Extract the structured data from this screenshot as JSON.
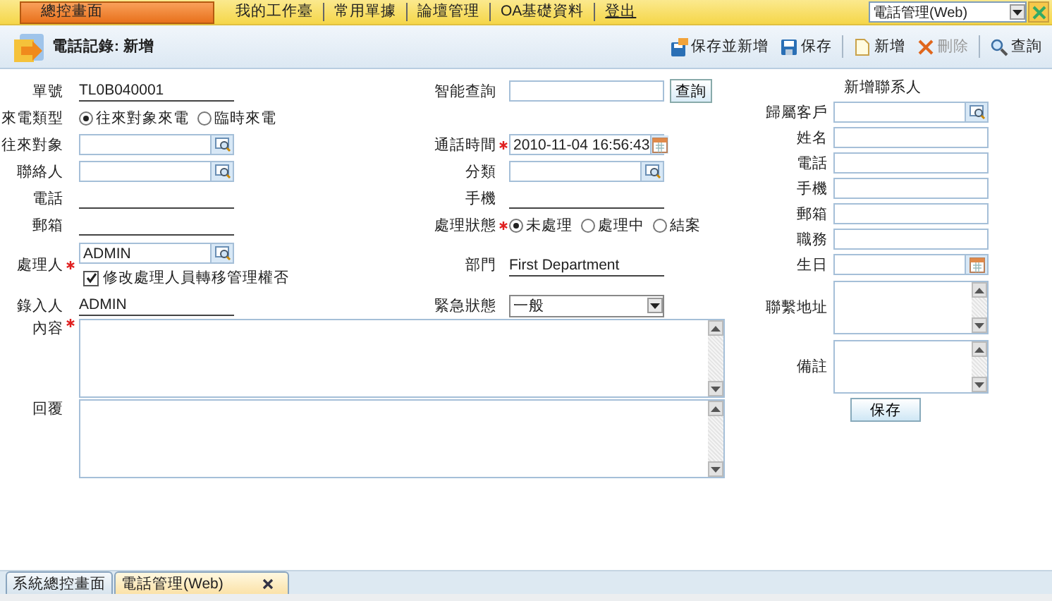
{
  "top_nav": {
    "items": [
      {
        "label": "總控畫面",
        "kind": "tab",
        "selected": true
      },
      {
        "label": "我的工作臺",
        "kind": "tab",
        "selected": false
      },
      {
        "label": "常用單據",
        "kind": "tab",
        "selected": false
      },
      {
        "label": "論壇管理",
        "kind": "tab",
        "selected": false
      },
      {
        "label": "OA基礎資料",
        "kind": "tab",
        "selected": false
      },
      {
        "label": "登出",
        "kind": "link",
        "selected": false
      }
    ],
    "module_select": {
      "value": "電話管理(Web)"
    }
  },
  "page_header": {
    "title": "電話記錄: 新增",
    "actions": [
      {
        "label": "保存並新增",
        "kind": "save_new",
        "disabled": false
      },
      {
        "label": "保存",
        "kind": "save",
        "disabled": false
      },
      {
        "label": "新增",
        "kind": "new",
        "disabled": false
      },
      {
        "label": "刪除",
        "kind": "delete",
        "disabled": true
      },
      {
        "label": "查詢",
        "kind": "search",
        "disabled": false
      }
    ]
  },
  "rows": [
    {
      "left": {
        "label": "單號",
        "kind": "text",
        "value": "TL0B040001"
      },
      "right": {
        "label": "智能查詢",
        "kind": "search",
        "button": "查詢"
      }
    },
    {
      "left": {
        "label": "來電類型",
        "kind": "radio",
        "options": [
          {
            "label": "往來對象來電",
            "selected": true
          },
          {
            "label": "臨時來電",
            "selected": false
          }
        ]
      }
    },
    {
      "left": {
        "label": "往來對象",
        "kind": "lookup"
      },
      "right": {
        "label": "通話時間",
        "required": true,
        "kind": "date",
        "value": "2010-11-04 16:56:43"
      }
    },
    {
      "left": {
        "label": "聯絡人",
        "kind": "lookup"
      },
      "right": {
        "label": "分類",
        "kind": "lookup"
      }
    },
    {
      "left": {
        "label": "電話",
        "kind": "text"
      },
      "right": {
        "label": "手機",
        "kind": "text"
      }
    },
    {
      "left": {
        "label": "郵箱",
        "kind": "text"
      },
      "right": {
        "label": "處理狀態",
        "required": true,
        "kind": "radio",
        "options": [
          {
            "label": "未處理",
            "selected": true
          },
          {
            "label": "處理中",
            "selected": false
          },
          {
            "label": "結案",
            "selected": false
          }
        ]
      }
    },
    {
      "left": {
        "label": "處理人",
        "required": true,
        "kind": "lookup",
        "value": "ADMIN",
        "checkbox": {
          "label": "修改處理人員轉移管理權否",
          "checked": true
        }
      },
      "right": {
        "label": "部門",
        "kind": "text",
        "value": "First Department"
      }
    },
    {
      "left": {
        "label": "錄入人",
        "kind": "text",
        "value": "ADMIN"
      },
      "right": {
        "label": "緊急狀態",
        "kind": "select",
        "value": "一般"
      }
    }
  ],
  "text_areas": [
    {
      "label": "內容",
      "required": true
    },
    {
      "label": "回覆",
      "required": false
    }
  ],
  "contact_panel": {
    "title": "新增聯系人",
    "fields": [
      {
        "label": "歸屬客戶",
        "kind": "lookup"
      },
      {
        "label": "姓名",
        "kind": "input"
      },
      {
        "label": "電話",
        "kind": "input"
      },
      {
        "label": "手機",
        "kind": "input"
      },
      {
        "label": "郵箱",
        "kind": "input"
      },
      {
        "label": "職務",
        "kind": "input"
      },
      {
        "label": "生日",
        "kind": "date"
      },
      {
        "label": "聯繫地址",
        "kind": "textarea"
      },
      {
        "label": "備註",
        "kind": "textarea"
      }
    ],
    "button": "保存"
  },
  "bottom_tabs": [
    {
      "label": "系統總控畫面",
      "selected": false,
      "closable": false
    },
    {
      "label": "電話管理(Web)",
      "selected": true,
      "closable": true
    }
  ]
}
